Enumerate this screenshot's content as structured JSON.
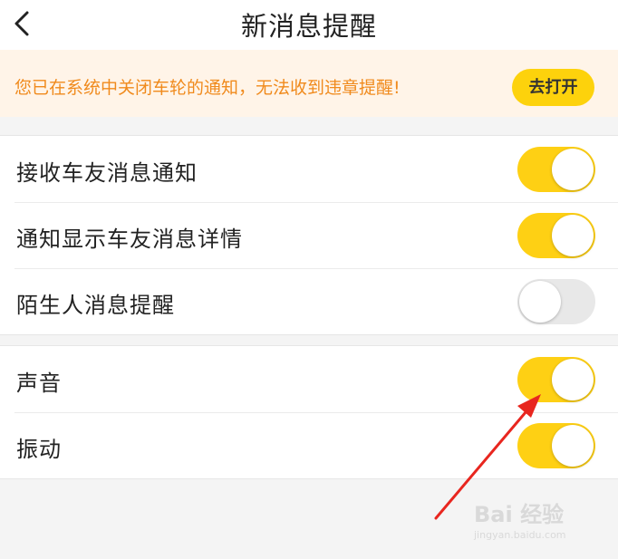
{
  "header": {
    "title": "新消息提醒",
    "back_icon": "chevron-left-icon"
  },
  "notice": {
    "text": "您已在系统中关闭车轮的通知，无法收到违章提醒!",
    "button_label": "去打开",
    "text_color": "#f08a1c",
    "background": "#fff4e8",
    "button_color": "#fdd20c"
  },
  "sections": [
    {
      "rows": [
        {
          "label": "接收车友消息通知",
          "enabled": true
        },
        {
          "label": "通知显示车友消息详情",
          "enabled": true
        },
        {
          "label": "陌生人消息提醒",
          "enabled": false
        }
      ]
    },
    {
      "rows": [
        {
          "label": "声音",
          "enabled": true
        },
        {
          "label": "振动",
          "enabled": true
        }
      ]
    }
  ],
  "colors": {
    "toggle_on": "#fed014",
    "toggle_off": "#e8e8e8",
    "annotation_arrow": "#e8261f"
  },
  "watermark": {
    "main": "Bai 经验",
    "sub": "jingyan.baidu.com"
  }
}
